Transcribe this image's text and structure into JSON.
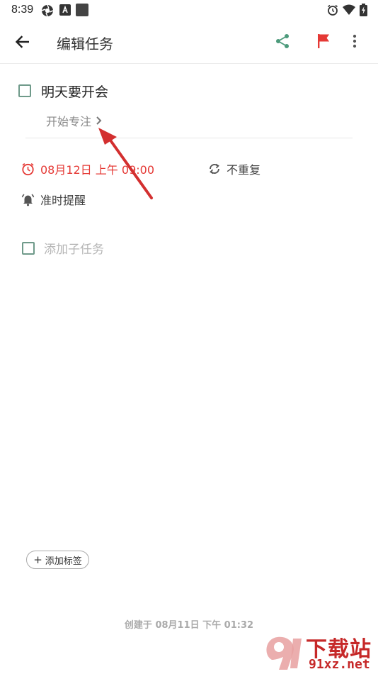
{
  "status_bar": {
    "time": "8:39",
    "left_icons": [
      "aperture-icon",
      "a-badge-icon",
      "square-app-icon"
    ],
    "right_icons": [
      "alarm-icon",
      "wifi-icon",
      "battery-charging-icon"
    ]
  },
  "app_bar": {
    "title": "编辑任务",
    "icons": [
      "back-arrow-icon",
      "share-icon",
      "flag-icon",
      "more-vert-icon"
    ],
    "flag_color": "#e53935",
    "share_color": "#4c9a7b"
  },
  "task": {
    "title": "明天要开会",
    "focus_label": "开始专注",
    "due_date": "08月12日 上午 09:00",
    "repeat": "不重复",
    "reminder": "准时提醒",
    "subtask_placeholder": "添加子任务"
  },
  "footer": {
    "add_tag_label": "添加标签",
    "created_text": "创建于 08月11日 下午 01:32"
  },
  "colors": {
    "accent_green": "#6f9a8a",
    "due_red": "#e53935",
    "arrow_red": "#d32f2f"
  },
  "watermark": {
    "cn": "下载站",
    "en": "91xz.net"
  }
}
